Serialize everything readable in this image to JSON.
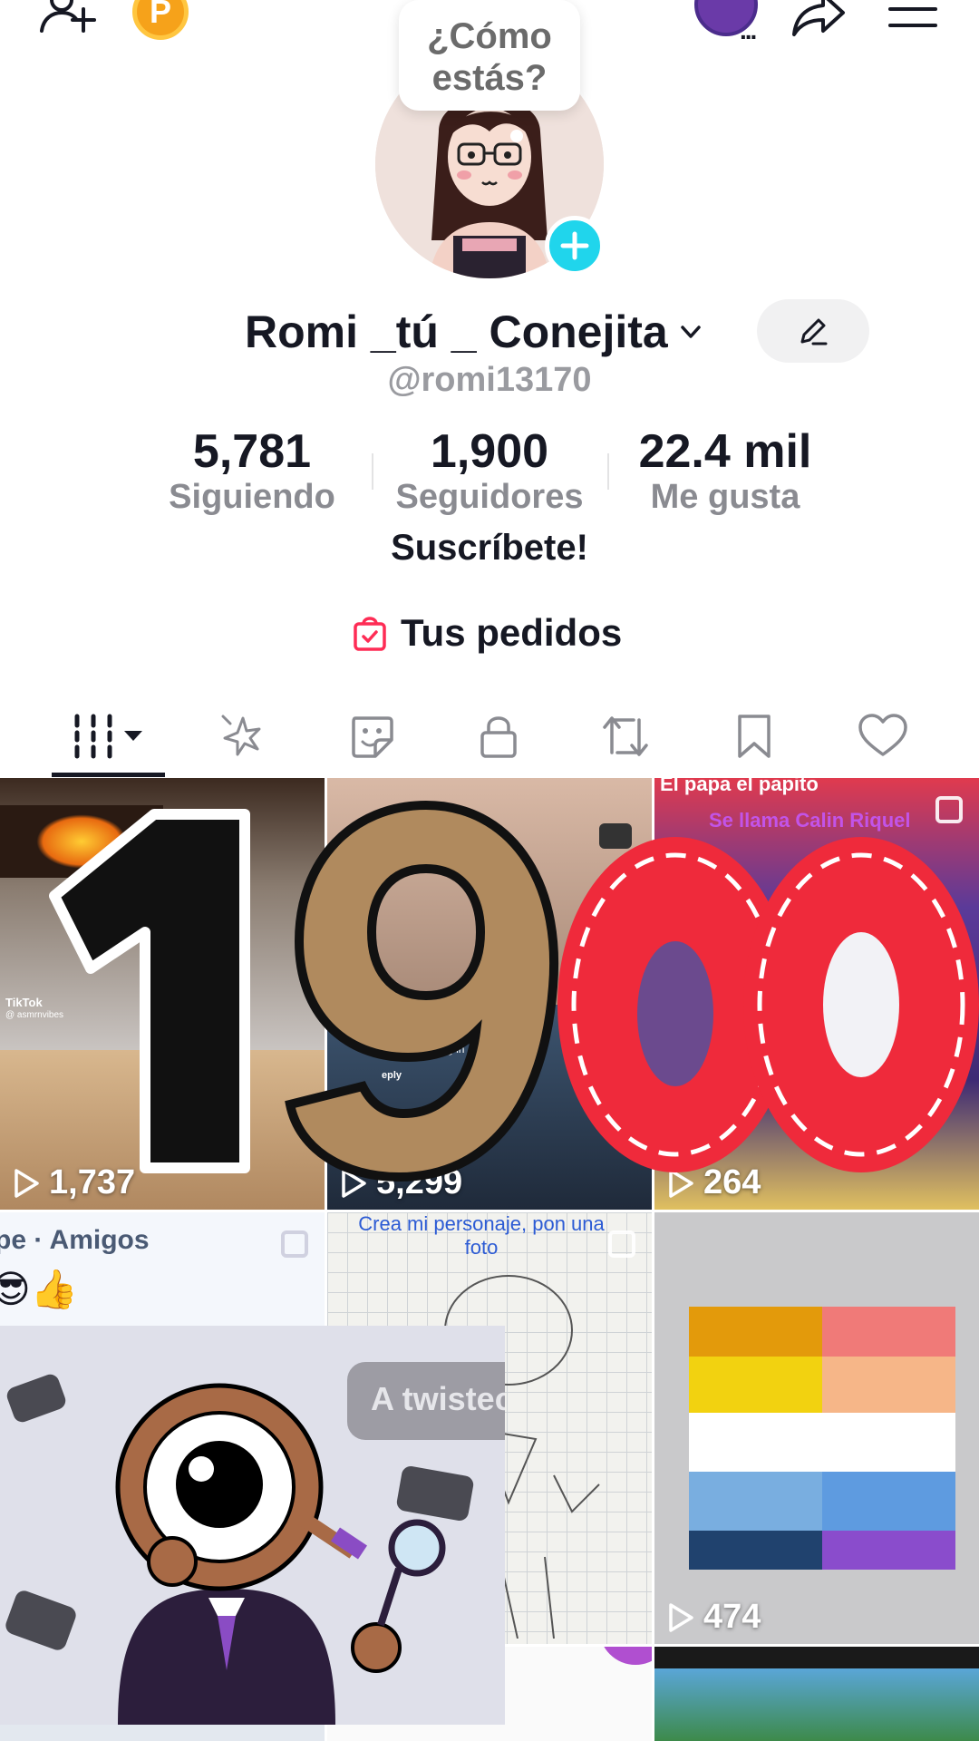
{
  "status": {
    "bubble_text": "¿Cómo estás?",
    "coin_letter": "P",
    "live_dots": "..."
  },
  "profile": {
    "display_name": "Romi _tú _ Conejita",
    "username": "@romi13170",
    "bio": "Suscríbete!",
    "orders_label": "Tus pedidos"
  },
  "stats": [
    {
      "value": "5,781",
      "label": "Siguiendo"
    },
    {
      "value": "1,900",
      "label": "Seguidores"
    },
    {
      "value": "22.4 mil",
      "label": "Me gusta"
    }
  ],
  "tabs": [
    {
      "icon": "grid-icon",
      "active": true
    },
    {
      "icon": "sparkle-icon",
      "active": false
    },
    {
      "icon": "sticker-icon",
      "active": false
    },
    {
      "icon": "lock-icon",
      "active": false
    },
    {
      "icon": "repost-icon",
      "active": false
    },
    {
      "icon": "bookmark-icon",
      "active": false
    },
    {
      "icon": "heart-icon",
      "active": false
    }
  ],
  "videos": [
    {
      "views": "1,737",
      "caption": "TikTok",
      "sub": "@ asmrnvibes"
    },
    {
      "views": "5,299",
      "caption": "Lets make hot dog in",
      "sub": "eply"
    },
    {
      "views": "264",
      "caption": "Se llama Calin Riquel",
      "sub": "El papa el papito"
    },
    {
      "views": "",
      "caption": "pe · Amigos",
      "sub": ""
    },
    {
      "views": "",
      "caption": "Crea mi personaje, pon una foto",
      "sub": ""
    },
    {
      "views": "474",
      "caption": "",
      "sub": ""
    }
  ],
  "overlay_sticker": {
    "text": "A twistec"
  },
  "overlay_number": "1900",
  "colors": {
    "accent_cyan": "#20d5ec",
    "coin": "#f6a21a",
    "orders_red": "#fe2c55"
  }
}
